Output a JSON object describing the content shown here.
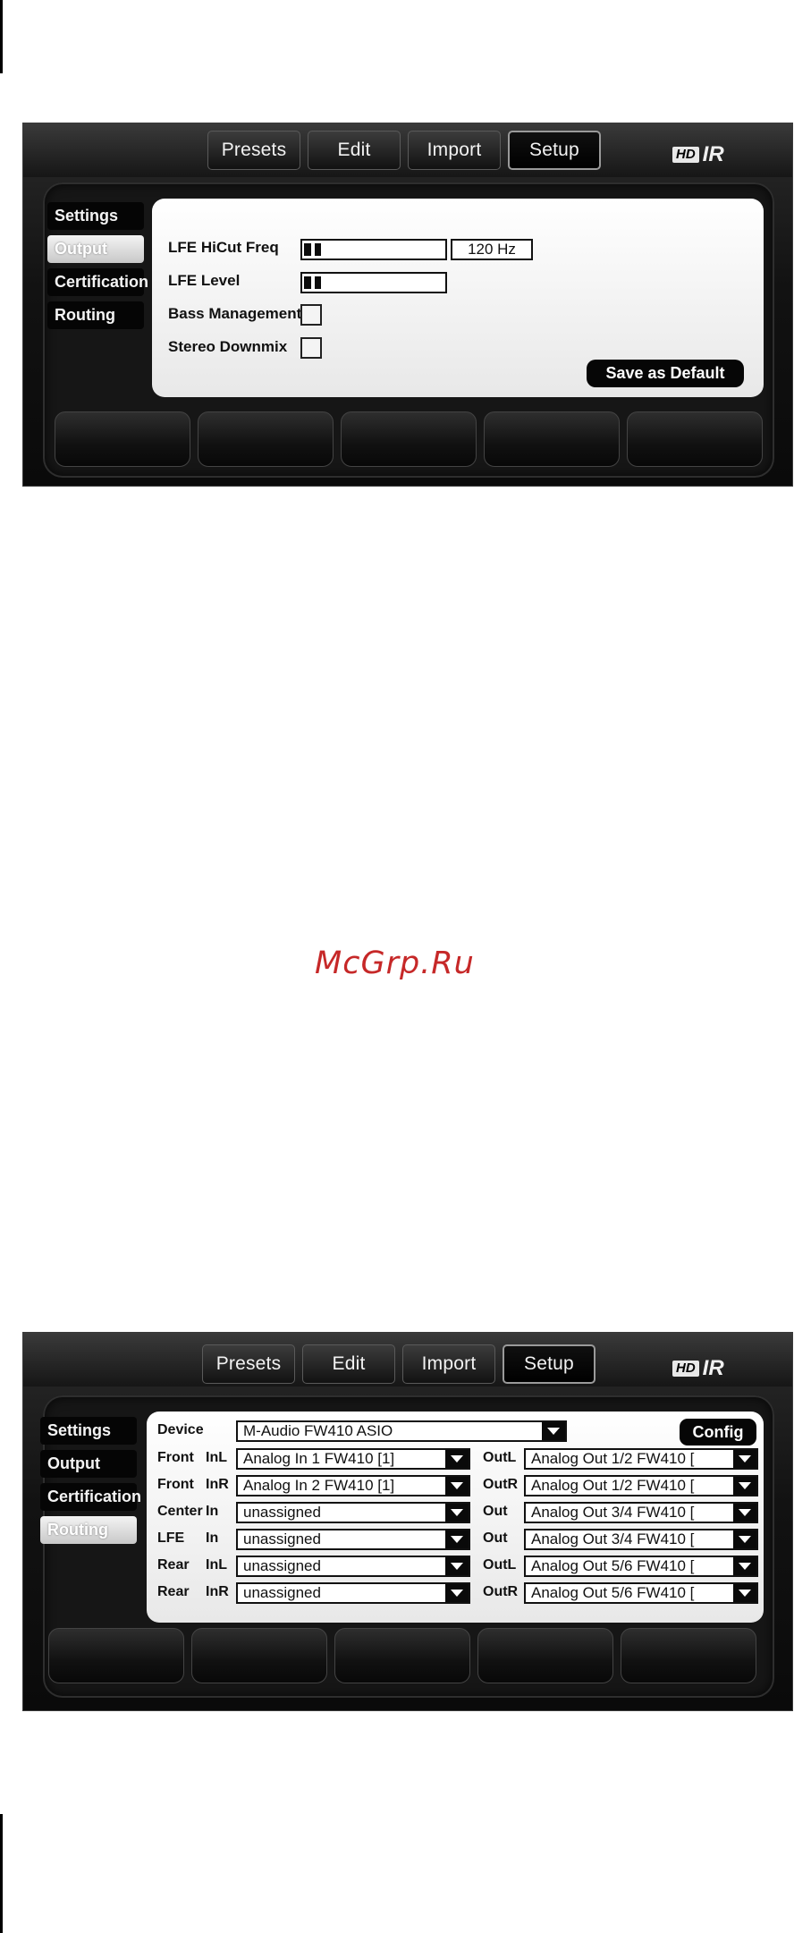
{
  "watermark": "McGrp.Ru",
  "nav": [
    "Presets",
    "Edit",
    "Import",
    "Setup"
  ],
  "logo": {
    "hd": "HD",
    "ir": "IR"
  },
  "sidebar": [
    "Settings",
    "Output",
    "Certification",
    "Routing"
  ],
  "output_panel": {
    "active_tab": "Output",
    "lfe_hicut_label": "LFE HiCut Freq",
    "lfe_hicut_value": "120 Hz",
    "lfe_hicut_level": 0.12,
    "lfe_level_label": "LFE Level",
    "lfe_level_level": 0.12,
    "bass_management_label": "Bass Management",
    "bass_management_checked": false,
    "stereo_downmix_label": "Stereo Downmix",
    "stereo_downmix_checked": false,
    "save_label": "Save as Default"
  },
  "routing_panel": {
    "active_tab": "Routing",
    "device_label": "Device",
    "device_value": "M-Audio FW410 ASIO",
    "config_label": "Config",
    "rows": [
      {
        "ch": "Front",
        "in_label": "InL",
        "in_value": "Analog In 1 FW410 [1]",
        "out_label": "OutL",
        "out_value": "Analog Out 1/2 FW410 ["
      },
      {
        "ch": "Front",
        "in_label": "InR",
        "in_value": "Analog In 2 FW410 [1]",
        "out_label": "OutR",
        "out_value": "Analog Out 1/2 FW410 ["
      },
      {
        "ch": "Center",
        "in_label": "In",
        "in_value": "unassigned",
        "out_label": "Out",
        "out_value": "Analog Out 3/4 FW410 ["
      },
      {
        "ch": "LFE",
        "in_label": "In",
        "in_value": "unassigned",
        "out_label": "Out",
        "out_value": "Analog Out 3/4 FW410 ["
      },
      {
        "ch": "Rear",
        "in_label": "InL",
        "in_value": "unassigned",
        "out_label": "OutL",
        "out_value": "Analog Out 5/6 FW410 ["
      },
      {
        "ch": "Rear",
        "in_label": "InR",
        "in_value": "unassigned",
        "out_label": "OutR",
        "out_value": "Analog Out 5/6 FW410 ["
      }
    ]
  }
}
